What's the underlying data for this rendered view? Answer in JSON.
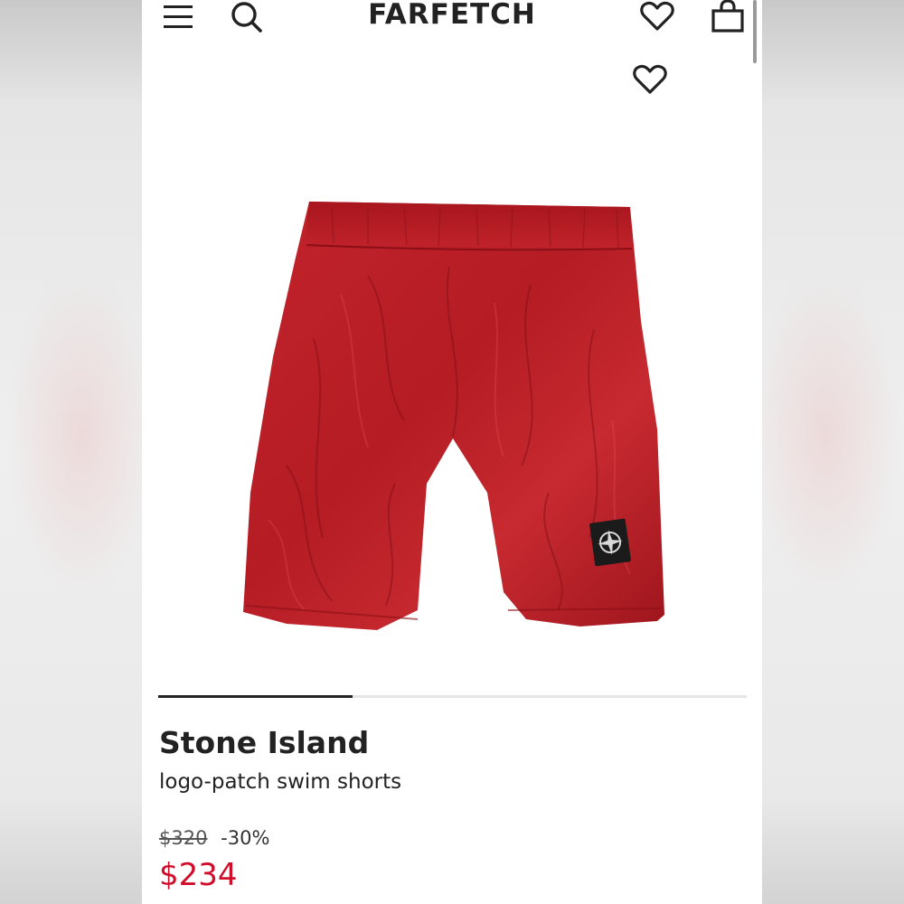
{
  "header": {
    "brand": "FARFETCH",
    "icons": [
      "menu-icon",
      "search-icon",
      "wishlist-icon",
      "bag-icon"
    ]
  },
  "product": {
    "image_icon": "red-swim-shorts",
    "carousel_progress": 0.33,
    "brand_name": "Stone Island",
    "description": "logo-patch swim shorts",
    "original_price": "$320",
    "discount": "-30%",
    "sale_price": "$234"
  },
  "colors": {
    "accent_sale": "#d10d2c",
    "text": "#222222",
    "shorts": "#b81c24"
  }
}
